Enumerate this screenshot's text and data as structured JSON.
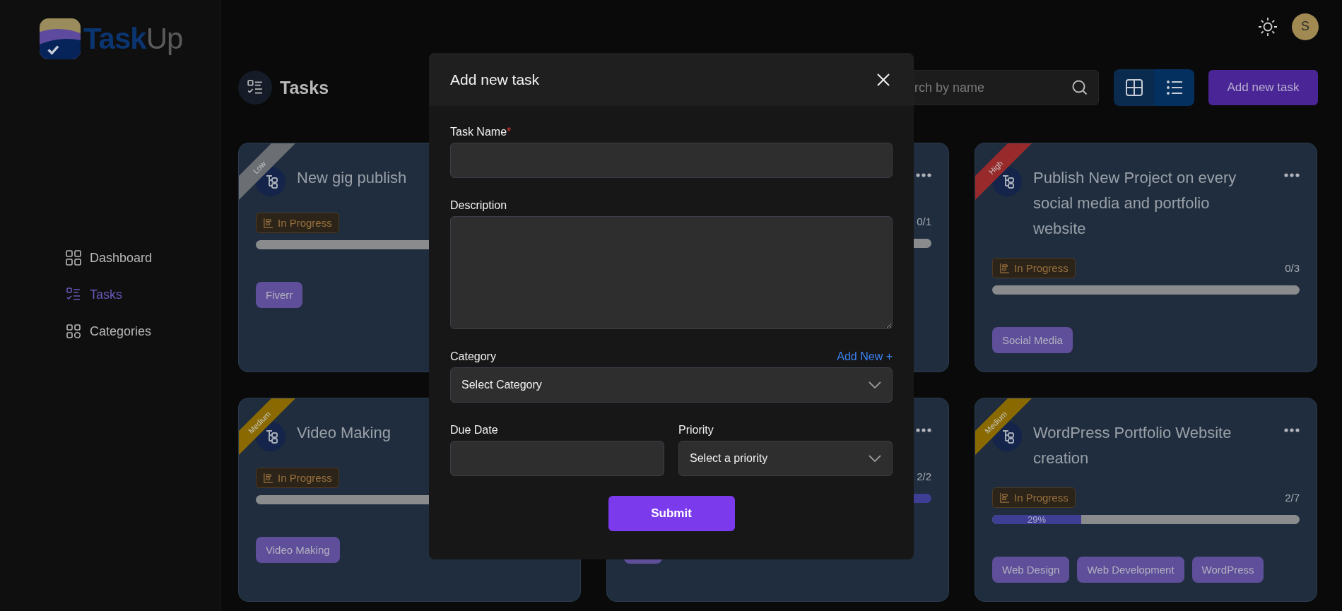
{
  "logo": {
    "part_1": "Task",
    "part_2": "Up"
  },
  "sidebar": {
    "items": [
      {
        "label": "Dashboard",
        "kind": "dashboard",
        "selected": false
      },
      {
        "label": "Tasks",
        "kind": "tasks",
        "selected": true
      },
      {
        "label": "Categories",
        "kind": "categories",
        "selected": false
      }
    ]
  },
  "topbar": {
    "avatar": "S"
  },
  "header": {
    "title": "Tasks",
    "search": {
      "placeholder": "rch by name"
    },
    "views": [
      {
        "kind": "grid",
        "selected": true
      },
      {
        "kind": "list",
        "selected": false
      }
    ],
    "add_button": "Add new task"
  },
  "cards": [
    {
      "ribbon": {
        "label": "Low",
        "color": "#6b6e72"
      },
      "title": "New gig publish",
      "status": "In Progress",
      "level": 0,
      "tags": [
        {
          "label": "Fiverr"
        }
      ]
    },
    {
      "menu": true,
      "fraction": "0/1",
      "level": 0
    },
    {
      "ribbon": {
        "label": "High",
        "color": "#982a2c"
      },
      "menu": true,
      "title": "Publish New Project on every social media and portfolio website",
      "status": "In Progress",
      "fraction": "0/3",
      "level": 0,
      "tags": [
        {
          "label": "Social Media"
        }
      ]
    },
    {
      "ribbon": {
        "label": "Medium",
        "color": "#8a6a00"
      },
      "title": "Video Making",
      "status": "In Progress",
      "level": 0,
      "tags": [
        {
          "label": "Video Making"
        }
      ]
    },
    {
      "menu": true,
      "fraction": "2/2",
      "level": 1,
      "tags": [
        {
          "kind": "covered"
        }
      ]
    },
    {
      "ribbon": {
        "label": "Medium",
        "color": "#8a6a00"
      },
      "menu": true,
      "title": "WordPress Portfolio Website creation",
      "status": "In Progress",
      "fraction": "2/7",
      "level": 0.29,
      "percent": "29%",
      "tags": [
        {
          "label": "Web Design"
        },
        {
          "label": "Web Development"
        },
        {
          "label": "WordPress"
        }
      ]
    }
  ],
  "modal": {
    "title": "Add new task",
    "task_name": {
      "label": "Task Name",
      "required_mark": "*"
    },
    "description": {
      "label": "Description"
    },
    "category": {
      "label": "Category",
      "link": "Add New +",
      "select": "Select Category"
    },
    "due_date": {
      "label": "Due Date"
    },
    "priority": {
      "label": "Priority",
      "select": "Select a priority"
    },
    "submit": "Submit"
  }
}
